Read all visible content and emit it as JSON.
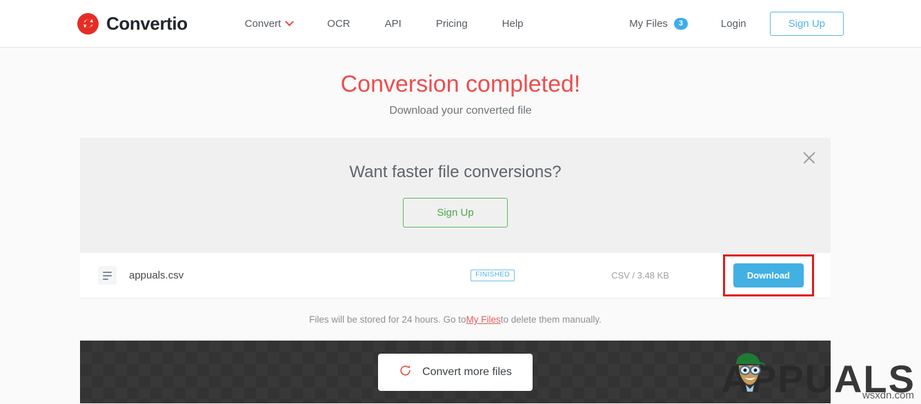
{
  "header": {
    "brand": {
      "name": "Convertio",
      "logo_icon": "convertio-logo-icon",
      "logo_color": "#e52d27"
    },
    "nav": [
      {
        "label": "Convert",
        "has_dropdown": true,
        "chevron_icon": "chevron-down-icon"
      },
      {
        "label": "OCR",
        "has_dropdown": false
      },
      {
        "label": "API",
        "has_dropdown": false
      },
      {
        "label": "Pricing",
        "has_dropdown": false
      },
      {
        "label": "Help",
        "has_dropdown": false
      }
    ],
    "my_files": {
      "label": "My Files",
      "count": "3",
      "badge_color": "#3dadea"
    },
    "login": {
      "label": "Login"
    },
    "signup": {
      "label": "Sign Up",
      "border_color": "#56b7e8"
    }
  },
  "page": {
    "title": "Conversion completed!",
    "title_color": "#ed4d4d",
    "subtitle": "Download your converted file"
  },
  "promo": {
    "title": "Want faster file conversions?",
    "signup_label": "Sign Up",
    "signup_color": "#5cb85c",
    "close_icon": "close-icon"
  },
  "file": {
    "icon": "file-lines-icon",
    "name": "appuals.csv",
    "status": "FINISHED",
    "status_color": "#53b2e0",
    "meta": "CSV / 3.48 KB",
    "download_label": "Download",
    "download_color": "#42b0e3",
    "highlight_color": "#e01b1b"
  },
  "notice": {
    "text_before": "Files will be stored for 24 hours. Go to ",
    "link": "My Files",
    "text_after": " to delete them manually."
  },
  "footer": {
    "convert_more_label": "Convert more files",
    "reload_icon": "reload-icon",
    "reload_color": "#e8483f"
  },
  "watermark": {
    "text": "APPUALS",
    "mascot_icon": "appuals-mascot-icon",
    "source": "wsxdn.com"
  }
}
